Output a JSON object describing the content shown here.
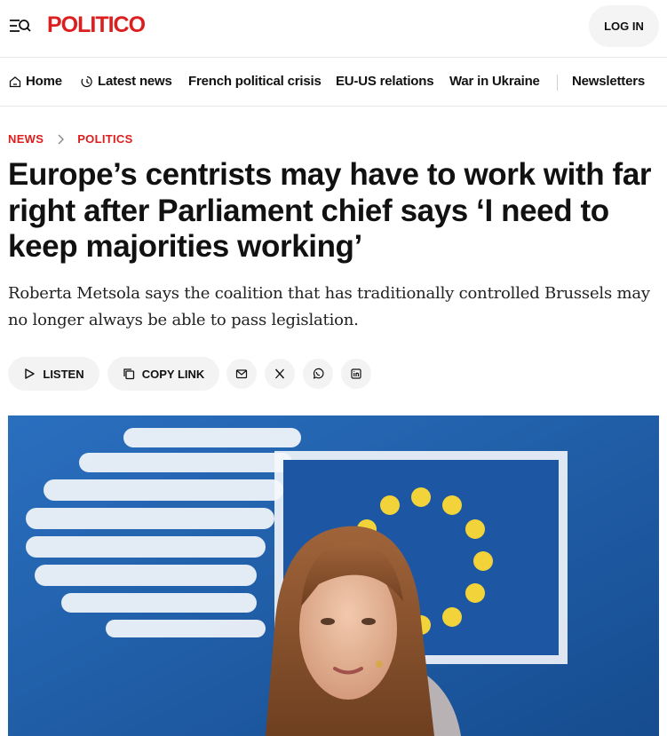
{
  "header": {
    "logo": "POLITICO",
    "login_label": "LOG IN"
  },
  "nav": {
    "items": [
      {
        "label": "Home",
        "icon": "home-icon"
      },
      {
        "label": "Latest news",
        "icon": "clock-icon"
      },
      {
        "label": "French political crisis"
      },
      {
        "label": "EU-US relations"
      },
      {
        "label": "War in Ukraine"
      },
      {
        "label": "Newsletters"
      }
    ]
  },
  "breadcrumb": {
    "section": "NEWS",
    "subsection": "POLITICS"
  },
  "article": {
    "headline": "Europe’s centrists may have to work with far right after Parliament chief says ‘I need to keep majorities working’",
    "dek": "Roberta Metsola says the coalition that has traditionally controlled Brussels may no longer always be able to pass legislation."
  },
  "actions": {
    "listen_label": "LISTEN",
    "copy_link_label": "COPY LINK"
  },
  "colors": {
    "brand_red": "#dc1e1e",
    "eu_blue": "#1f5fa8",
    "eu_star": "#f2d43a"
  }
}
